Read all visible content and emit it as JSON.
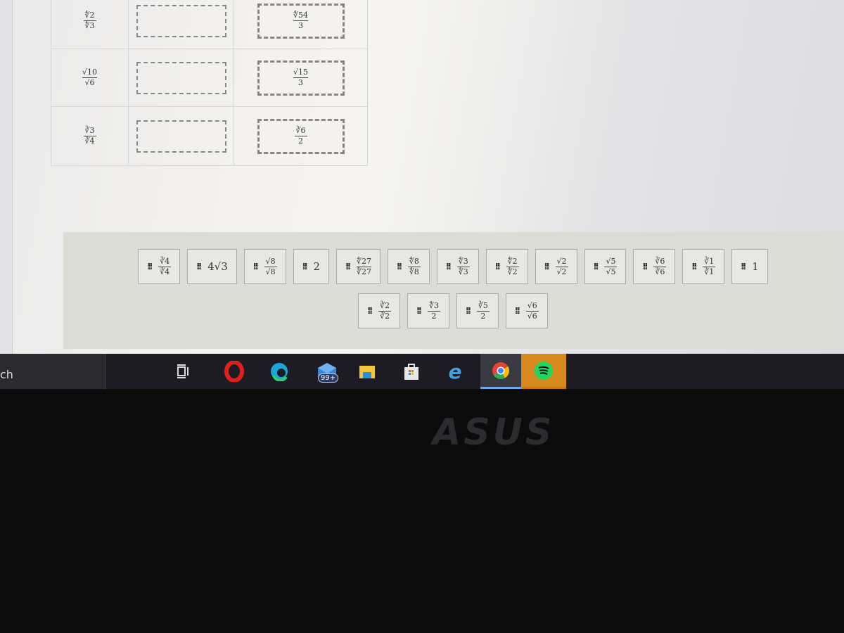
{
  "table": {
    "rows": [
      {
        "question": {
          "num": "∜2",
          "den": "∜3"
        },
        "answer": {
          "num": "∜54",
          "den": "3"
        }
      },
      {
        "question": {
          "num": "√10",
          "den": "√6"
        },
        "answer": {
          "num": "√15",
          "den": "3"
        }
      },
      {
        "question": {
          "num": "∛3",
          "den": "∛4"
        },
        "answer": {
          "num": "∛6",
          "den": "2"
        }
      }
    ]
  },
  "tiles_row1": [
    {
      "num": "∛4",
      "den": "∛4"
    },
    {
      "text": "4√3"
    },
    {
      "num": "√8",
      "den": "√8"
    },
    {
      "text": "2"
    },
    {
      "num": "∜27",
      "den": "∜27"
    },
    {
      "num": "∜8",
      "den": "∜8"
    },
    {
      "num": "∜3",
      "den": "∜3"
    },
    {
      "num": "∜2",
      "den": "∜2"
    },
    {
      "num": "√2",
      "den": "√2"
    },
    {
      "num": "√5",
      "den": "√5"
    },
    {
      "num": "∛6",
      "den": "∛6"
    },
    {
      "num": "∛1",
      "den": "∛1"
    },
    {
      "text": "1"
    }
  ],
  "tiles_row2": [
    {
      "num": "∛2",
      "den": "∛2"
    },
    {
      "num": "∜3",
      "den": "2"
    },
    {
      "num": "∛5",
      "den": "2"
    },
    {
      "num": "√6",
      "den": "√6"
    }
  ],
  "grip_icon": "drag-handle-icon",
  "taskbar": {
    "search_text": "ch",
    "mail_badge": "99+",
    "icons": [
      "task-view-icon",
      "opera-icon",
      "edge-icon",
      "mail-icon",
      "file-explorer-icon",
      "store-icon",
      "internet-explorer-icon",
      "chrome-icon",
      "spotify-icon"
    ]
  },
  "bezel_logo": "ASUS"
}
